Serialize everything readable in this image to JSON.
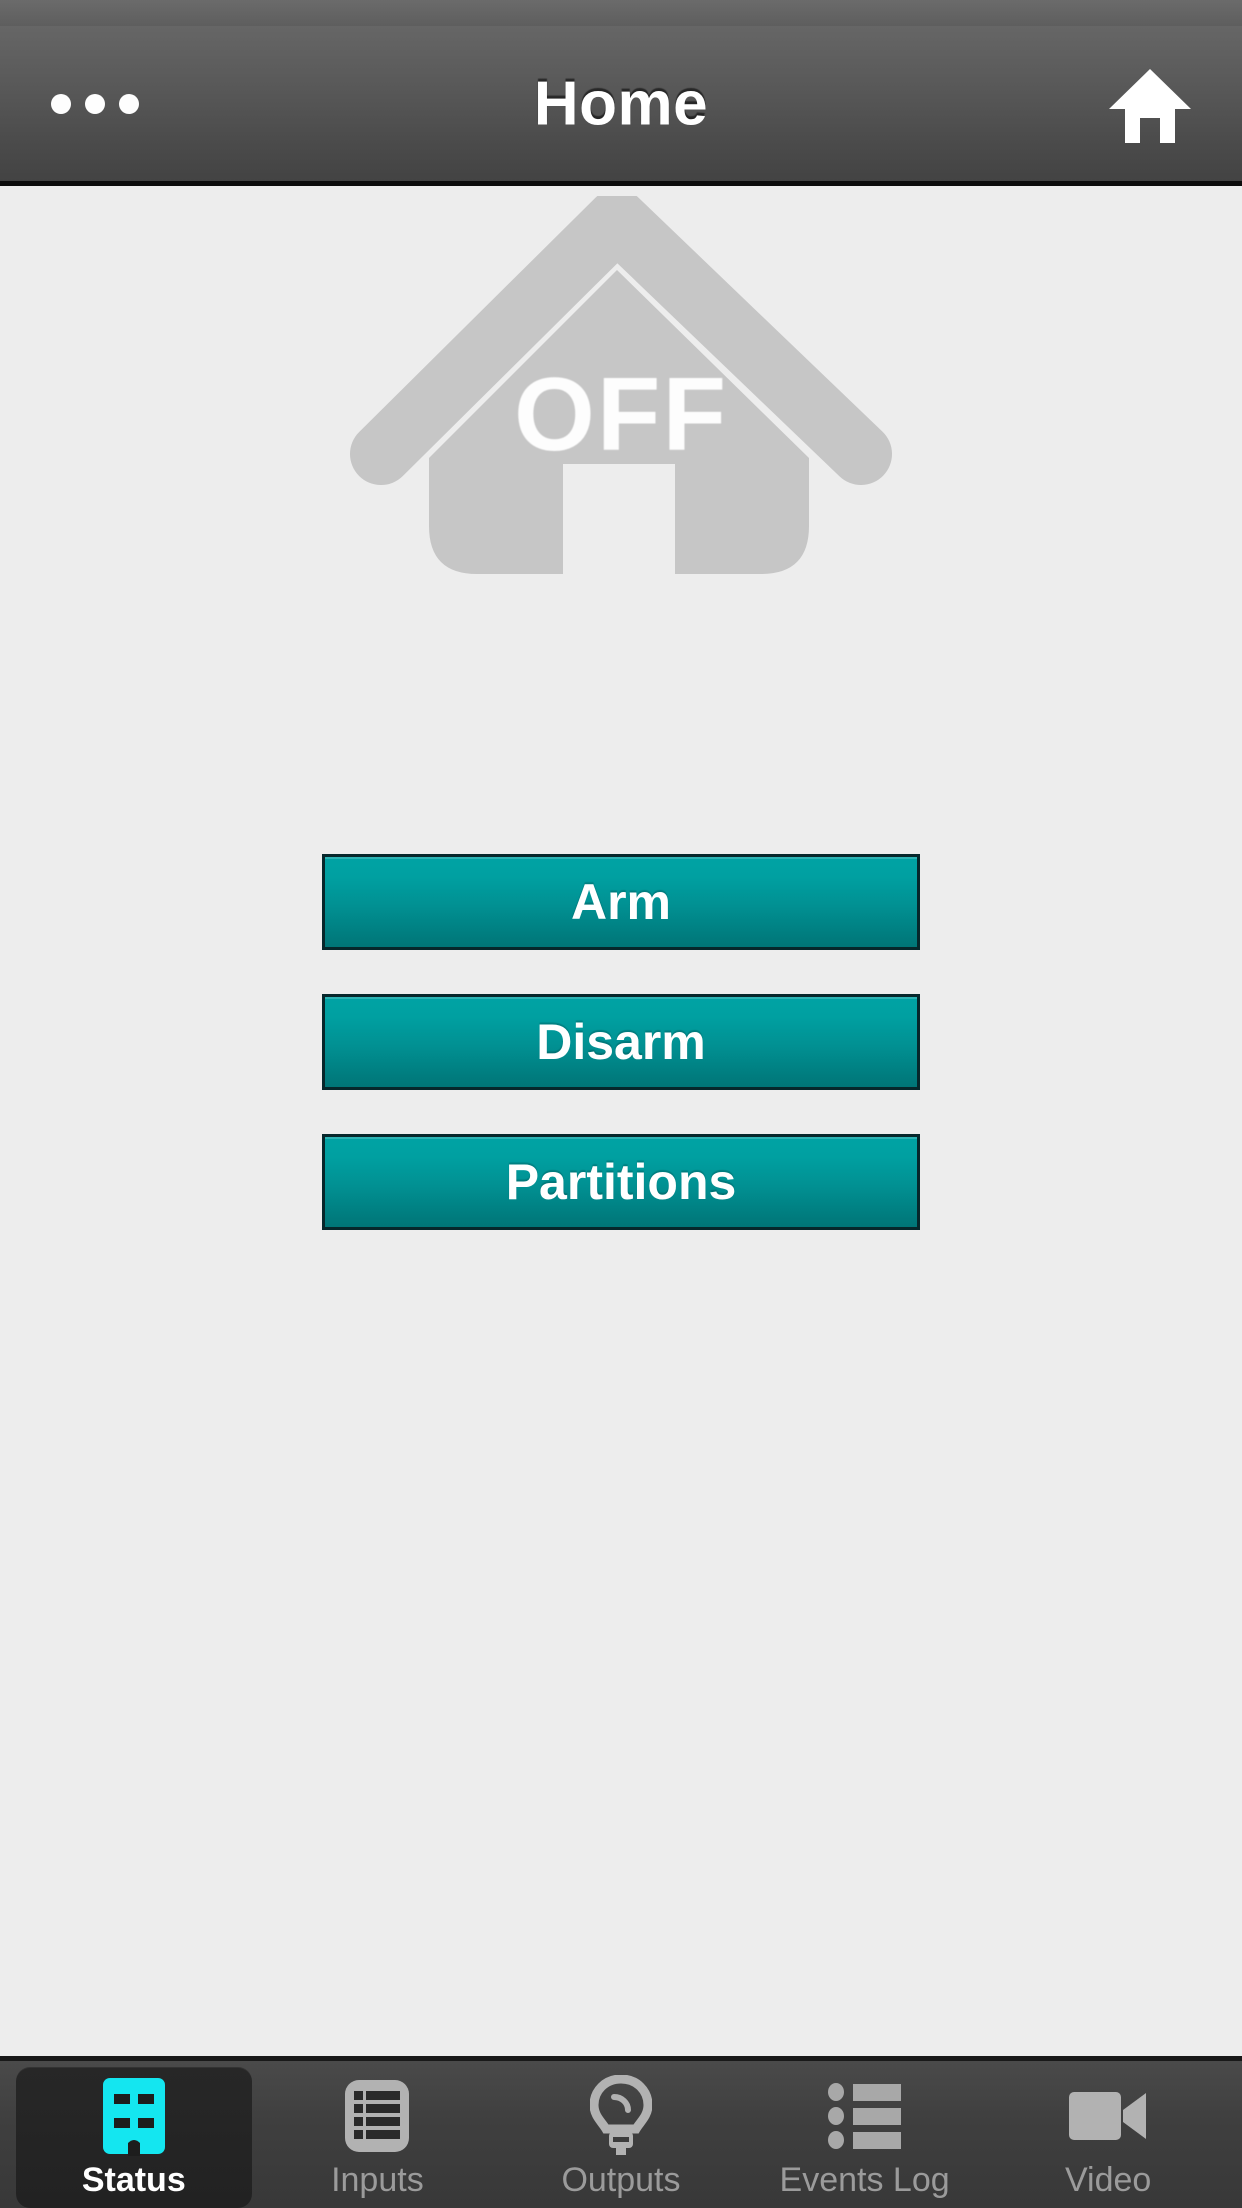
{
  "app": {
    "screen_title": "Home",
    "background_color": "#ededed",
    "accent_color": "#00a0a1",
    "active_tab_color": "#14e6f0"
  },
  "header": {
    "title": "Home",
    "overflow_icon": "more-options-icon",
    "home_icon": "home-icon"
  },
  "status": {
    "state_label": "OFF",
    "graphic_icon": "house-icon",
    "graphic_color": "#c5c5c5"
  },
  "actions": [
    {
      "label": "Arm",
      "name": "arm-button"
    },
    {
      "label": "Disarm",
      "name": "disarm-button"
    },
    {
      "label": "Partitions",
      "name": "partitions-button"
    }
  ],
  "tabs": [
    {
      "label": "Status",
      "icon": "building-icon",
      "active": true
    },
    {
      "label": "Inputs",
      "icon": "list-table-icon",
      "active": false
    },
    {
      "label": "Outputs",
      "icon": "lightbulb-icon",
      "active": false
    },
    {
      "label": "Events Log",
      "icon": "bullet-list-icon",
      "active": false
    },
    {
      "label": "Video",
      "icon": "video-camera-icon",
      "active": false
    }
  ]
}
